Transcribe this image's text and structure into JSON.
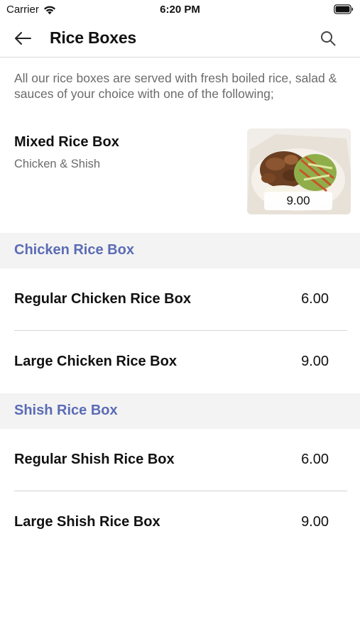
{
  "status_bar": {
    "carrier": "Carrier",
    "time": "6:20 PM"
  },
  "nav": {
    "title": "Rice Boxes",
    "back_icon": "arrow-left-icon",
    "search_icon": "search-icon"
  },
  "intro": "All our rice boxes are served with fresh boiled rice, salad & sauces of your choice with one of the following;",
  "featured": {
    "name": "Mixed Rice Box",
    "description": "Chicken & Shish",
    "price": "9.00"
  },
  "sections": [
    {
      "title": "Chicken Rice Box",
      "items": [
        {
          "name": "Regular Chicken Rice Box",
          "price": "6.00"
        },
        {
          "name": "Large Chicken Rice Box",
          "price": "9.00"
        }
      ]
    },
    {
      "title": "Shish Rice Box",
      "items": [
        {
          "name": "Regular Shish Rice Box",
          "price": "6.00"
        },
        {
          "name": "Large Shish Rice Box",
          "price": "9.00"
        }
      ]
    }
  ],
  "colors": {
    "section_title": "#5b6bb5",
    "section_bg": "#f3f3f3",
    "muted_text": "#6b6b6b"
  }
}
